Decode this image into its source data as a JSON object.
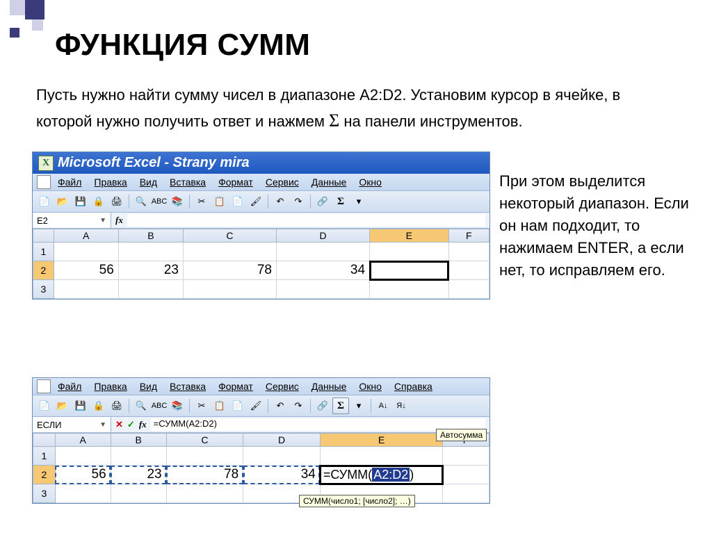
{
  "slide": {
    "title": "ФУНКЦИЯ СУММ",
    "intro_part1": "Пусть нужно найти сумму чисел в диапазоне A2:D2. Установим курсор в ячейке, в которой нужно получить ответ и нажмем ",
    "intro_sigma": "Σ",
    "intro_part2": " на панели инструментов.",
    "side_note": "При этом выделится некоторый диапазон. Если он нам подходит, то нажимаем ENTER, а если нет, то исправляем его."
  },
  "excel1": {
    "app_title": "Microsoft Excel - Strany mira",
    "app_icon_text": "X",
    "menu": [
      "Файл",
      "Правка",
      "Вид",
      "Вставка",
      "Формат",
      "Сервис",
      "Данные",
      "Окно"
    ],
    "namebox": "E2",
    "fx_label": "fx",
    "sigma": "Σ",
    "columns": [
      "A",
      "B",
      "C",
      "D",
      "E",
      "F"
    ],
    "rows": [
      "1",
      "2",
      "3"
    ],
    "row2": {
      "A": "56",
      "B": "23",
      "C": "78",
      "D": "34"
    }
  },
  "excel2": {
    "menu": [
      "Файл",
      "Правка",
      "Вид",
      "Вставка",
      "Формат",
      "Сервис",
      "Данные",
      "Окно",
      "Справка"
    ],
    "namebox": "ЕСЛИ",
    "fx_label": "fx",
    "formula": "=СУММ(A2:D2)",
    "sigma": "Σ",
    "autosum_tooltip": "Автосумма",
    "columns": [
      "A",
      "B",
      "C",
      "D",
      "E",
      "F"
    ],
    "rows": [
      "1",
      "2",
      "3"
    ],
    "row2": {
      "A": "56",
      "B": "23",
      "C": "78",
      "D": "34"
    },
    "cell_formula_prefix": "=СУММ(",
    "cell_formula_range": "A2:D2",
    "cell_formula_suffix": ")",
    "hint": "СУММ(число1; [число2]; …)"
  }
}
